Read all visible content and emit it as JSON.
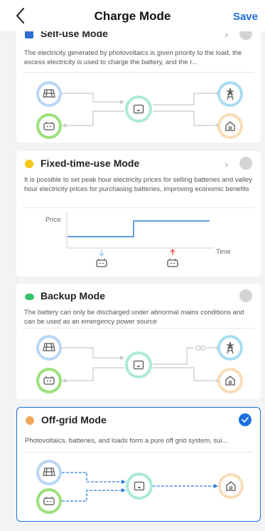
{
  "header": {
    "title": "Charge Mode",
    "save_label": "Save"
  },
  "cards": [
    {
      "title": "Self-use Mode",
      "description": "The electricity generated by photovoltaics is given priority to the load, the excess electricity is used to charge the battery, and the r...",
      "icon_color": "#2f6fd4",
      "has_chevron": true,
      "selected": false
    },
    {
      "title": "Fixed-time-use Mode",
      "description": "It is possible to set peak hour electricity prices for selling batteries and valley hour electricity prices for purchasing batteries, improving economic benefits",
      "icon_color": "#f5c518",
      "has_chevron": true,
      "selected": false,
      "price_chart": {
        "y_label": "Price",
        "x_label": "Time"
      }
    },
    {
      "title": "Backup Mode",
      "description": "The battery can only be discharged under abnormal mains conditions and can be used as an emergency power source",
      "icon_color": "#38c06b",
      "has_chevron": false,
      "selected": false
    },
    {
      "title": "Off-grid  Mode",
      "description": "Photovoltaics, batteries, and loads form a pure off grid system, sui...",
      "icon_color": "#f0a65a",
      "has_chevron": false,
      "selected": true
    }
  ],
  "icons": {
    "back": "chevron-left-icon",
    "solar": "solar-panel-icon",
    "battery": "battery-icon",
    "inverter": "inverter-icon",
    "grid": "power-tower-icon",
    "home": "home-icon",
    "check": "check-icon",
    "chevron": "chevron-right-icon"
  },
  "colors": {
    "accent": "#1e6fdb",
    "solar_ring": "#b9d6f5",
    "battery_ring": "#9be07a",
    "inverter_ring": "#a9ead6",
    "grid_ring": "#a8ddf2",
    "home_ring": "#f9dcb8"
  }
}
